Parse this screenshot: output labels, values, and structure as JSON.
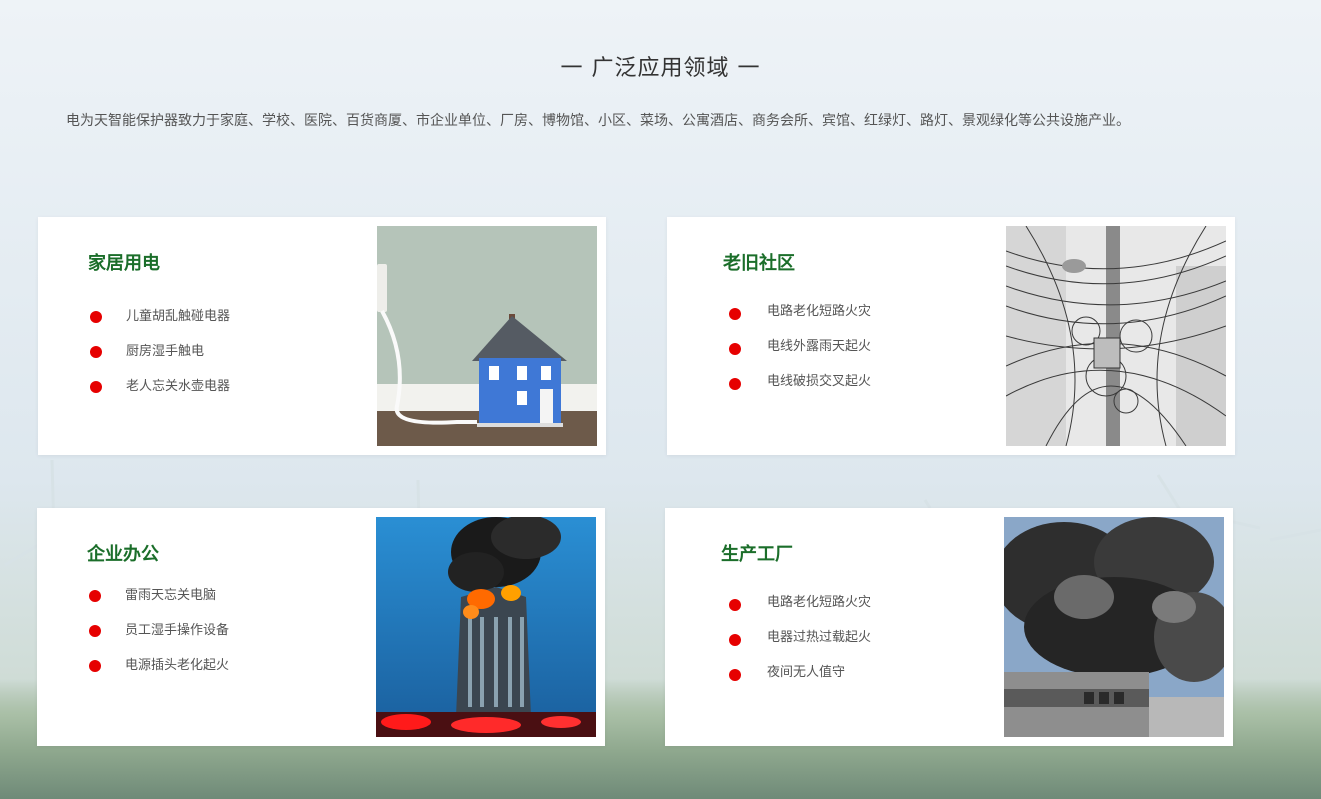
{
  "section": {
    "title": "一 广泛应用领域 一",
    "description": "电为天智能保护器致力于家庭、学校、医院、百货商厦、市企业单位、厂房、博物馆、小区、菜场、公寓酒店、商务会所、宾馆、红绿灯、路灯、景观绿化等公共设施产业。"
  },
  "cards": [
    {
      "title": "家居用电",
      "items": [
        "儿童胡乱触碰电器",
        "厨房湿手触电",
        "老人忘关水壶电器"
      ],
      "image": "house-with-plug-photo"
    },
    {
      "title": "老旧社区",
      "items": [
        "电路老化短路火灾",
        "电线外露雨天起火",
        "电线破损交叉起火"
      ],
      "image": "tangled-wires-pole-photo"
    },
    {
      "title": "企业办公",
      "items": [
        "雷雨天忘关电脑",
        "员工湿手操作设备",
        "电源插头老化起火"
      ],
      "image": "burning-office-tower-photo"
    },
    {
      "title": "生产工厂",
      "items": [
        "电路老化短路火灾",
        "电器过热过载起火",
        "夜间无人值守"
      ],
      "image": "factory-smoke-photo"
    }
  ],
  "colors": {
    "title_green": "#1b6e2a",
    "bullet_red": "#e60000",
    "card_bg": "#ffffff"
  }
}
